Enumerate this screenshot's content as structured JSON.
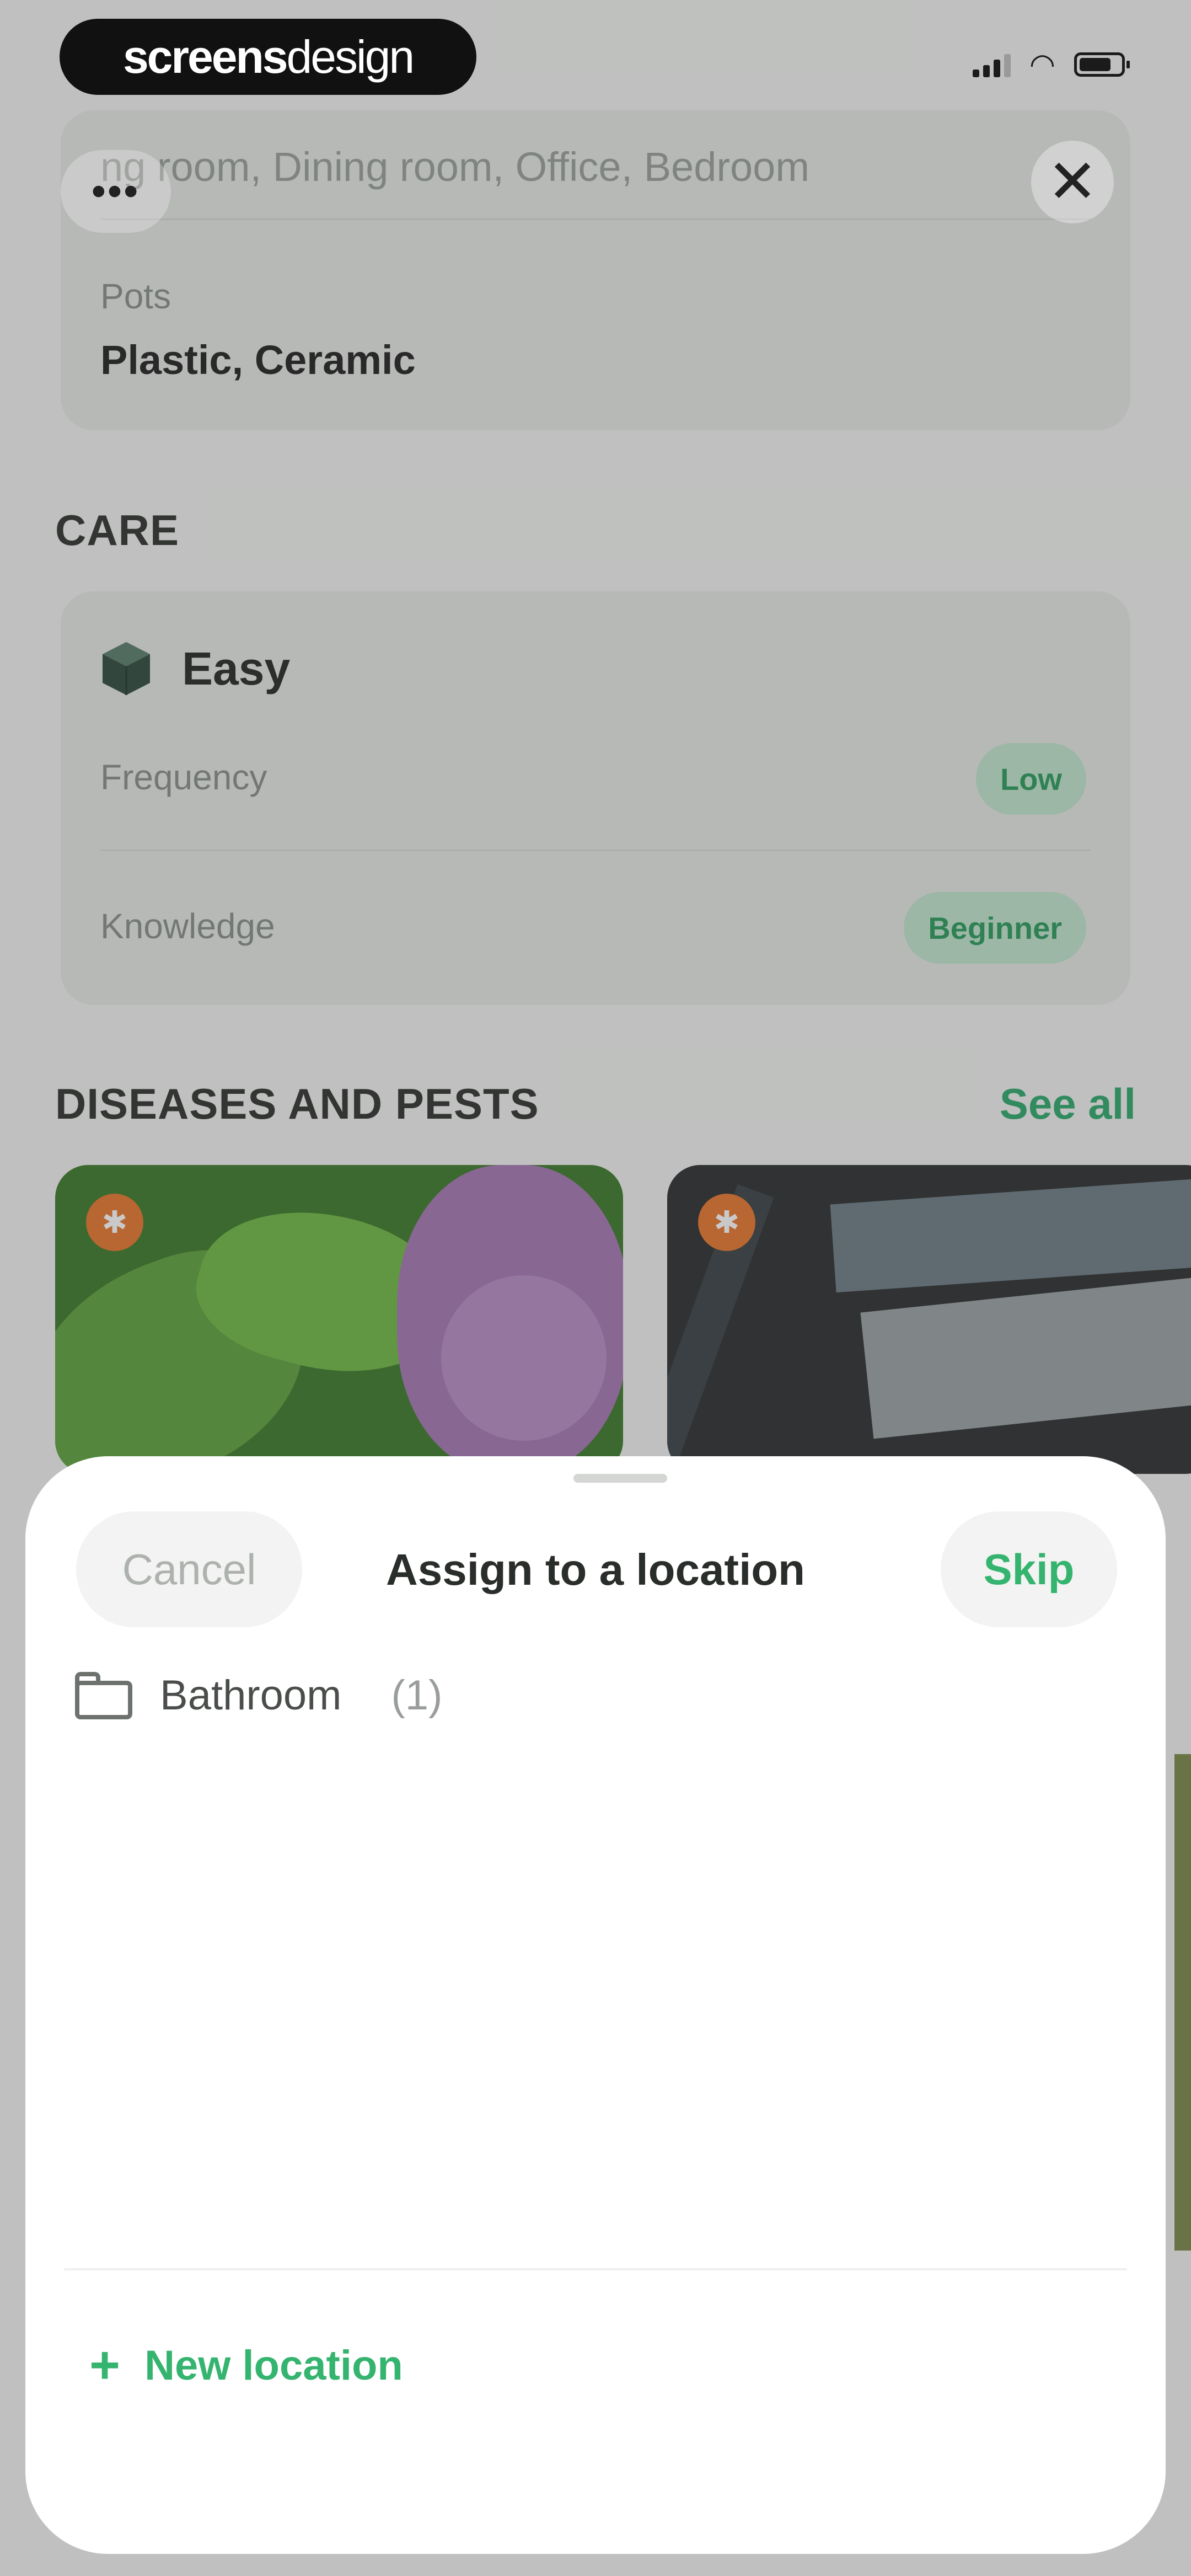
{
  "watermark": {
    "bold": "screens",
    "light": "design"
  },
  "header": {
    "more_label": "•••",
    "close_label": "✕"
  },
  "location_card": {
    "placement_value": "ng room, Dining room, Office, Bedroom",
    "pots_label": "Pots",
    "pots_value": "Plastic, Ceramic"
  },
  "care": {
    "section_title": "CARE",
    "difficulty": "Easy",
    "frequency_label": "Frequency",
    "frequency_value": "Low",
    "knowledge_label": "Knowledge",
    "knowledge_value": "Beginner"
  },
  "diseases": {
    "section_title": "DISEASES AND PESTS",
    "see_all_label": "See all",
    "badge_icon": "warning-icon"
  },
  "sheet": {
    "cancel_label": "Cancel",
    "title": "Assign to a location",
    "skip_label": "Skip",
    "locations": [
      {
        "name": "Bathroom",
        "count": "(1)",
        "icon": "folder-icon"
      }
    ],
    "new_location_label": "New location"
  },
  "colors": {
    "accent_green": "#35b46f",
    "pill_bg": "#c3e6cf",
    "badge_orange": "#e8762e"
  }
}
